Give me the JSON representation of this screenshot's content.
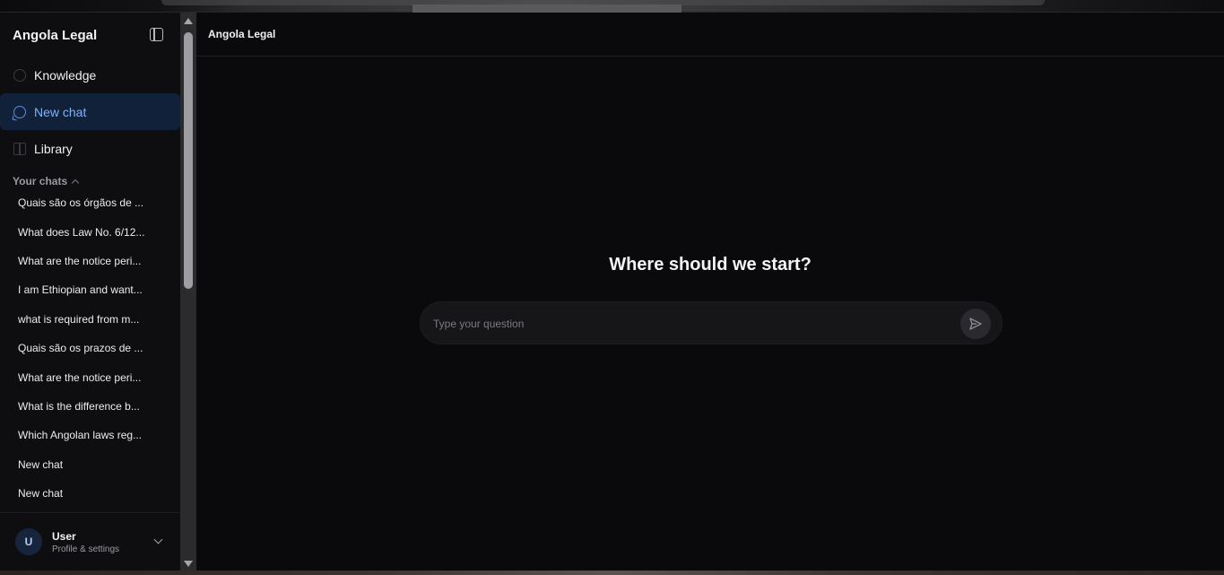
{
  "sidebar": {
    "brand": "Angola Legal",
    "nav": [
      {
        "label": "Knowledge",
        "icon": "search-icon"
      },
      {
        "label": "New chat",
        "icon": "chat-bubble-icon"
      },
      {
        "label": "Library",
        "icon": "book-icon"
      }
    ],
    "section_label": "Your chats",
    "chats": [
      "Quais são os órgãos de ...",
      "What does Law No. 6/12...",
      "What are the notice peri...",
      "I am Ethiopian and want...",
      "what is required from m...",
      "Quais são os prazos de ...",
      "What are the notice peri...",
      "What is the difference b...",
      "Which Angolan laws reg...",
      "New chat",
      "New chat"
    ],
    "user": {
      "initial": "U",
      "name": "User",
      "subtitle": "Profile & settings"
    }
  },
  "main": {
    "header_title": "Angola Legal",
    "hero": "Where should we start?",
    "input_placeholder": "Type your question"
  },
  "colors": {
    "background": "#0a0a0c",
    "sidebar": "#0e0e11",
    "accent": "#7fb2ff",
    "active_item": "#11213a"
  }
}
